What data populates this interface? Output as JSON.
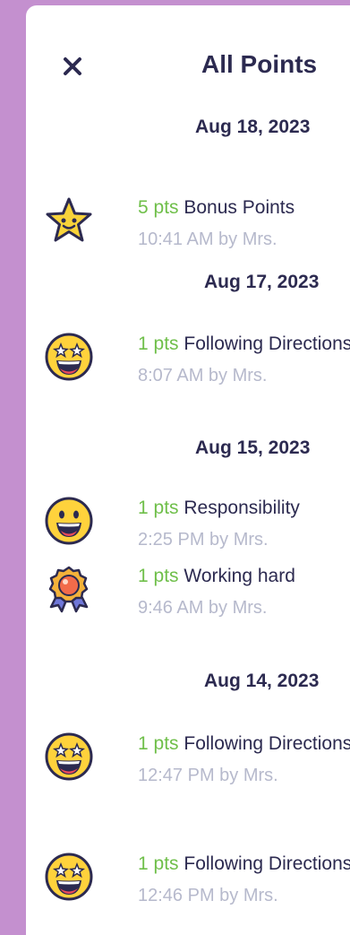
{
  "header": {
    "title": "All Points",
    "close_icon": "close-icon"
  },
  "groups": [
    {
      "date": "Aug 18, 2023",
      "items": [
        {
          "pts": "5 pts",
          "reason": "Bonus Points",
          "meta": "10:41 AM by Mrs.",
          "icon": "star-icon"
        }
      ]
    },
    {
      "date": "Aug 17, 2023",
      "items": [
        {
          "pts": "1 pts",
          "reason": "Following Directions",
          "meta": "8:07 AM by Mrs.",
          "icon": "star-eyes-emoji-icon"
        }
      ]
    },
    {
      "date": "Aug 15, 2023",
      "items": [
        {
          "pts": "1 pts",
          "reason": "Responsibility",
          "meta": "2:25 PM by Mrs.",
          "icon": "smiley-emoji-icon"
        },
        {
          "pts": "1 pts",
          "reason": "Working hard",
          "meta": "9:46 AM by Mrs.",
          "icon": "award-ribbon-icon"
        }
      ]
    },
    {
      "date": "Aug 14, 2023",
      "items": [
        {
          "pts": "1 pts",
          "reason": "Following Directions",
          "meta": "12:47 PM by Mrs.",
          "icon": "star-eyes-emoji-icon"
        },
        {
          "pts": "1 pts",
          "reason": "Following Directions",
          "meta": "12:46 PM by Mrs.",
          "icon": "star-eyes-emoji-icon"
        }
      ]
    }
  ],
  "colors": {
    "background": "#c490cf",
    "title_text": "#2c2a50",
    "points_green": "#6fbf4a",
    "meta_gray": "#b6b9cc"
  }
}
